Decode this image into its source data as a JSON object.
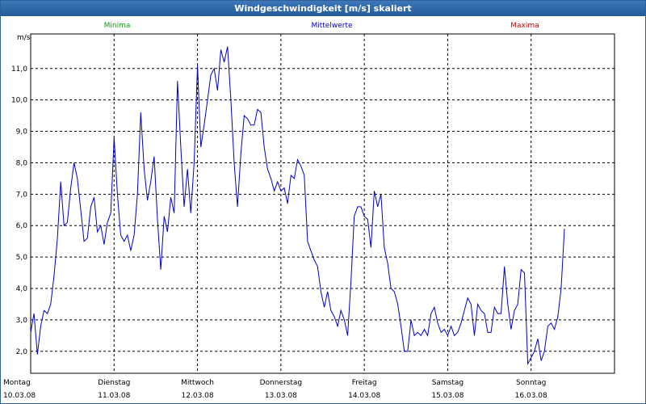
{
  "window": {
    "title": "Windgeschwindigkeit [m/s] skaliert"
  },
  "legend": [
    {
      "label": "Minima",
      "color": "#00aa00"
    },
    {
      "label": "Mittelwerte",
      "color": "#0000cc"
    },
    {
      "label": "Maxima",
      "color": "#cc0000"
    }
  ],
  "chart_data": {
    "type": "line",
    "title": "Windgeschwindigkeit [m/s] skaliert",
    "ylabel": "m/s",
    "xlabel": "",
    "ylim": [
      1.3,
      12.1
    ],
    "yticks": [
      "2,0",
      "3,0",
      "4,0",
      "5,0",
      "6,0",
      "7,0",
      "8,0",
      "9,0",
      "10,0",
      "11,0"
    ],
    "ytick_values": [
      2,
      3,
      4,
      5,
      6,
      7,
      8,
      9,
      10,
      11
    ],
    "x_categories": [
      {
        "day": "Montag",
        "date": "10.03.08"
      },
      {
        "day": "Dienstag",
        "date": "11.03.08"
      },
      {
        "day": "Mittwoch",
        "date": "12.03.08"
      },
      {
        "day": "Donnerstag",
        "date": "13.03.08"
      },
      {
        "day": "Freitag",
        "date": "14.03.08"
      },
      {
        "day": "Samstag",
        "date": "15.03.08"
      },
      {
        "day": "Sonntag",
        "date": "16.03.08"
      }
    ],
    "grid": true,
    "line_color": "#0000cc",
    "series": [
      {
        "name": "Mittelwerte",
        "x_days": [
          0,
          0.04,
          0.08,
          0.12,
          0.16,
          0.2,
          0.24,
          0.28,
          0.32,
          0.36,
          0.4,
          0.44,
          0.48,
          0.52,
          0.56,
          0.6,
          0.64,
          0.68,
          0.72,
          0.76,
          0.8,
          0.84,
          0.88,
          0.92,
          0.96,
          1.0,
          1.04,
          1.08,
          1.12,
          1.16,
          1.2,
          1.24,
          1.28,
          1.32,
          1.36,
          1.4,
          1.44,
          1.48,
          1.52,
          1.56,
          1.6,
          1.64,
          1.68,
          1.72,
          1.76,
          1.8,
          1.84,
          1.88,
          1.92,
          1.96,
          2.0,
          2.04,
          2.08,
          2.12,
          2.16,
          2.2,
          2.24,
          2.28,
          2.32,
          2.36,
          2.4,
          2.44,
          2.48,
          2.52,
          2.56,
          2.6,
          2.64,
          2.68,
          2.72,
          2.76,
          2.8,
          2.84,
          2.88,
          2.92,
          2.96,
          3.0,
          3.04,
          3.08,
          3.12,
          3.16,
          3.2,
          3.24,
          3.28,
          3.32,
          3.36,
          3.4,
          3.44,
          3.48,
          3.52,
          3.56,
          3.6,
          3.64,
          3.68,
          3.72,
          3.76,
          3.8,
          3.84,
          3.88,
          3.92,
          3.96,
          4.0,
          4.04,
          4.08,
          4.12,
          4.16,
          4.2,
          4.24,
          4.28,
          4.32,
          4.36,
          4.4,
          4.44,
          4.48,
          4.52,
          4.56,
          4.6,
          4.64,
          4.68,
          4.72,
          4.76,
          4.8,
          4.84,
          4.88,
          4.92,
          4.96,
          5.0,
          5.04,
          5.08,
          5.12,
          5.16,
          5.2,
          5.24,
          5.28,
          5.32,
          5.36,
          5.4,
          5.44,
          5.48,
          5.52,
          5.56,
          5.6,
          5.64,
          5.68,
          5.72,
          5.76,
          5.8,
          5.84,
          5.88,
          5.92,
          5.96,
          6.0,
          6.04,
          6.08,
          6.12,
          6.16,
          6.2,
          6.24,
          6.28,
          6.32,
          6.36,
          6.4,
          6.44,
          6.48,
          6.52,
          6.56,
          6.6,
          6.64,
          6.68,
          6.72,
          6.76,
          6.8,
          6.84,
          6.88,
          6.92,
          6.96,
          6.99
        ],
        "values": [
          2.6,
          3.2,
          1.9,
          2.8,
          3.3,
          3.2,
          3.5,
          4.4,
          5.6,
          7.4,
          6.0,
          6.1,
          7.2,
          8.0,
          7.5,
          6.5,
          5.5,
          5.6,
          6.6,
          6.9,
          5.8,
          6.0,
          5.4,
          6.1,
          6.4,
          8.8,
          7.0,
          5.7,
          5.5,
          5.7,
          5.2,
          5.7,
          7.0,
          9.6,
          7.8,
          6.8,
          7.4,
          8.2,
          6.2,
          4.6,
          6.3,
          5.8,
          6.9,
          6.4,
          10.6,
          8.5,
          6.6,
          7.8,
          6.4,
          8.0,
          11.1,
          8.5,
          9.2,
          10.0,
          10.8,
          11.0,
          10.3,
          11.6,
          11.2,
          11.7,
          10.0,
          8.0,
          6.6,
          8.3,
          9.5,
          9.4,
          9.2,
          9.2,
          9.7,
          9.6,
          8.5,
          7.8,
          7.5,
          7.1,
          7.4,
          7.1,
          7.2,
          6.7,
          7.6,
          7.5,
          8.1,
          7.9,
          7.6,
          5.5,
          5.2,
          4.9,
          4.7,
          3.9,
          3.4,
          3.9,
          3.3,
          3.1,
          2.8,
          3.3,
          3.0,
          2.5,
          4.2,
          6.3,
          6.6,
          6.6,
          6.3,
          6.2,
          5.3,
          7.1,
          6.6,
          7.0,
          5.3,
          4.8,
          4.0,
          3.9,
          3.5,
          2.8,
          2.0,
          2.0,
          3.0,
          2.5,
          2.6,
          2.5,
          2.7,
          2.5,
          3.2,
          3.4,
          2.9,
          2.6,
          2.7,
          2.5,
          2.8,
          2.5,
          2.6,
          2.9,
          3.3,
          3.7,
          3.5,
          2.5,
          3.5,
          3.3,
          3.2,
          2.6,
          2.6,
          3.4,
          3.2,
          3.2,
          4.7,
          3.5,
          2.7,
          3.3,
          3.5,
          4.6,
          4.5,
          1.6,
          1.8,
          2.0,
          2.4,
          1.7,
          2.0,
          2.8,
          2.9,
          2.7,
          3.1,
          4.0,
          5.9
        ]
      }
    ]
  }
}
